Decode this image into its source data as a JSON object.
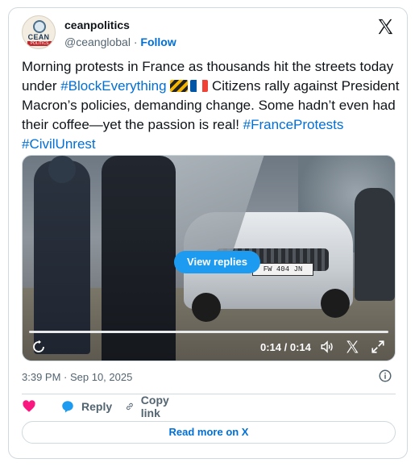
{
  "author": {
    "name": "ceanpolitics",
    "handle": "@ceanglobal",
    "separator": "·",
    "follow_label": "Follow",
    "avatar_logo_top": "CEAN",
    "avatar_logo_bottom": "POLITICS"
  },
  "tweet": {
    "text_1": "Morning protests in France as thousands hit the streets today under ",
    "hashtag_1": "#BlockEverything",
    "text_2": " Citizens rally against President Macron’s policies, demanding change. Some hadn’t even had their coffee—yet the passion is real! ",
    "hashtag_2": "#FranceProtests",
    "text_3": " ",
    "hashtag_3": "#CivilUnrest"
  },
  "media": {
    "view_replies_label": "View replies",
    "time": "0:14 / 0:14",
    "plate": "FW 404 JN",
    "progress_fraction": 1.0
  },
  "meta": {
    "timestamp": "3:39 PM · Sep 10, 2025"
  },
  "actions": {
    "reply_label": "Reply",
    "copy_label": "Copy link"
  },
  "footer": {
    "read_more_label": "Read more on X"
  },
  "colors": {
    "link_blue": "#006fd6",
    "button_blue": "#1d9bf0",
    "heart_red": "#f91880",
    "text_gray": "#536471"
  },
  "icons": [
    "x-logo-icon",
    "replay-icon",
    "volume-icon",
    "close-icon",
    "expand-icon",
    "info-icon",
    "heart-icon",
    "reply-bubble-icon",
    "link-icon"
  ]
}
